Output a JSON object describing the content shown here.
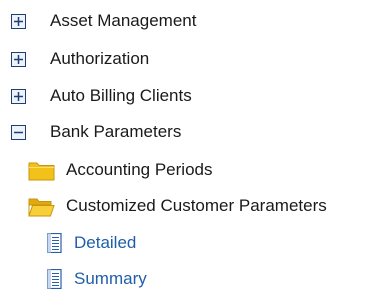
{
  "tree": {
    "asset_management": {
      "label": "Asset Management",
      "state": "collapsed",
      "toggle_icon": "plus-box-icon"
    },
    "authorization": {
      "label": "Authorization",
      "state": "collapsed",
      "toggle_icon": "plus-box-icon"
    },
    "auto_billing_clients": {
      "label": "Auto Billing Clients",
      "state": "collapsed",
      "toggle_icon": "plus-box-icon"
    },
    "bank_parameters": {
      "label": "Bank Parameters",
      "state": "expanded",
      "toggle_icon": "minus-box-icon",
      "children": {
        "accounting_periods": {
          "label": "Accounting Periods",
          "icon": "closed-folder-icon",
          "state": "closed"
        },
        "customized_customer_parameters": {
          "label": "Customized Customer Parameters",
          "icon": "open-folder-icon",
          "state": "open",
          "children": {
            "detailed": {
              "label": "Detailed",
              "icon": "document-icon"
            },
            "summary": {
              "label": "Summary",
              "icon": "document-icon"
            }
          }
        }
      }
    }
  },
  "colors": {
    "toggle_border": "#1d3f73",
    "folder_yellow": "#f2c21a",
    "link_blue": "#1f5fa8",
    "text": "#1a1a1a"
  }
}
